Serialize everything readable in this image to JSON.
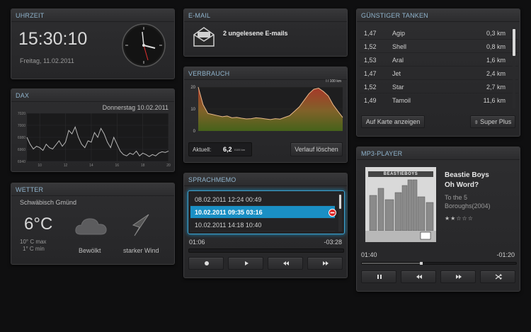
{
  "uhrzeit": {
    "title": "UHRZEIT",
    "time": "15:30:10",
    "date": "Freitag, 11.02.2011"
  },
  "dax": {
    "title": "DAX",
    "date": "Donnerstag 10.02.2011",
    "chart_data": {
      "type": "line",
      "title": "",
      "ylim": [
        6950,
        7020
      ],
      "y_ticks": [
        "7020",
        "7000",
        "6980",
        "6960",
        "6940"
      ],
      "x_ticks": [
        "10",
        "12",
        "14",
        "16",
        "18",
        "20"
      ],
      "x": [
        9,
        9.25,
        9.5,
        9.75,
        10,
        10.25,
        10.5,
        10.75,
        11,
        11.25,
        11.5,
        11.75,
        12,
        12.25,
        12.5,
        12.75,
        13,
        13.25,
        13.5,
        13.75,
        14,
        14.25,
        14.5,
        14.75,
        15,
        15.25,
        15.5,
        15.75,
        16,
        16.25,
        16.5,
        16.75,
        17,
        17.25,
        17.5,
        17.75,
        18,
        18.25,
        18.5,
        18.75,
        19,
        19.25,
        19.5,
        19.75,
        20
      ],
      "values": [
        6985,
        6975,
        6968,
        6972,
        6970,
        6966,
        6975,
        6970,
        6968,
        6974,
        6980,
        6972,
        6978,
        6995,
        6990,
        7000,
        6985,
        6975,
        6970,
        6980,
        6978,
        6992,
        6985,
        6998,
        6990,
        6978,
        6970,
        6985,
        6975,
        6965,
        6960,
        6958,
        6962,
        6960,
        6965,
        6958,
        6962,
        6960,
        6957,
        6960,
        6958,
        6962,
        6964,
        6963,
        6965
      ]
    }
  },
  "wetter": {
    "title": "WETTER",
    "city": "Schwäbisch Gmünd",
    "temp": "6°C",
    "max": "10° C max",
    "min": "1° C min",
    "condition": "Bewölkt",
    "wind": "starker Wind"
  },
  "email": {
    "title": "E-MAIL",
    "message": "2 ungelesene E-mails"
  },
  "verbrauch": {
    "title": "VERBRAUCH",
    "unit": "l / 100 km",
    "current_label": "Aktuell:",
    "current_value": "6,2",
    "current_unit": "l/100 km",
    "clear_button": "Verlauf löschen",
    "chart_data": {
      "type": "area",
      "title": "",
      "ylabel": "l / 100 km",
      "ylim": [
        0,
        20
      ],
      "y_ticks": [
        "20",
        "10",
        "0"
      ],
      "x": [
        0,
        1,
        2,
        3,
        4,
        5,
        6,
        7,
        8,
        9,
        10,
        11,
        12,
        13,
        14,
        15,
        16,
        17,
        18,
        19,
        20,
        21,
        22,
        23,
        24,
        25,
        26,
        27,
        28,
        29,
        30
      ],
      "values": [
        20,
        12,
        8,
        7.5,
        7,
        6.5,
        6.8,
        6,
        6.2,
        5.8,
        5.5,
        5.6,
        6,
        5.8,
        5.5,
        5.2,
        5.6,
        5.4,
        6.2,
        7,
        9,
        11,
        14,
        17,
        19,
        19.5,
        18,
        16,
        12,
        9,
        6.2
      ]
    }
  },
  "sprachmemo": {
    "title": "SPRACHMEMO",
    "items": [
      {
        "label": "08.02.2011 12:24 00:49"
      },
      {
        "label": "10.02.2011 09:35 03:16"
      },
      {
        "label": "10.02.2011 14:18 10:40"
      }
    ],
    "selected_index": 1,
    "elapsed": "01:06",
    "remaining": "-03:28"
  },
  "tanken": {
    "title": "GÜNSTIGER TANKEN",
    "rows": [
      {
        "price": "1,47",
        "name": "Agip",
        "dist": "0,3 km"
      },
      {
        "price": "1,52",
        "name": "Shell",
        "dist": "0,8 km"
      },
      {
        "price": "1,53",
        "name": "Aral",
        "dist": "1,6 km"
      },
      {
        "price": "1,47",
        "name": "Jet",
        "dist": "2,4 km"
      },
      {
        "price": "1,52",
        "name": "Star",
        "dist": "2,7 km"
      },
      {
        "price": "1,49",
        "name": "Tamoil",
        "dist": "11,6 km"
      }
    ],
    "map_button": "Auf Karte anzeigen",
    "fuel_select": "Super Plus"
  },
  "mp3": {
    "title": "MP3-PLAYER",
    "artist": "Beastie Boys",
    "song": "Oh Word?",
    "album_line1": "To the 5",
    "album_line2": "Boroughs(2004)",
    "rating": "★★☆☆☆",
    "cover_logo": "BEASTIEBOYS",
    "elapsed": "01:40",
    "remaining": "-01:20",
    "progress": 0.38
  }
}
